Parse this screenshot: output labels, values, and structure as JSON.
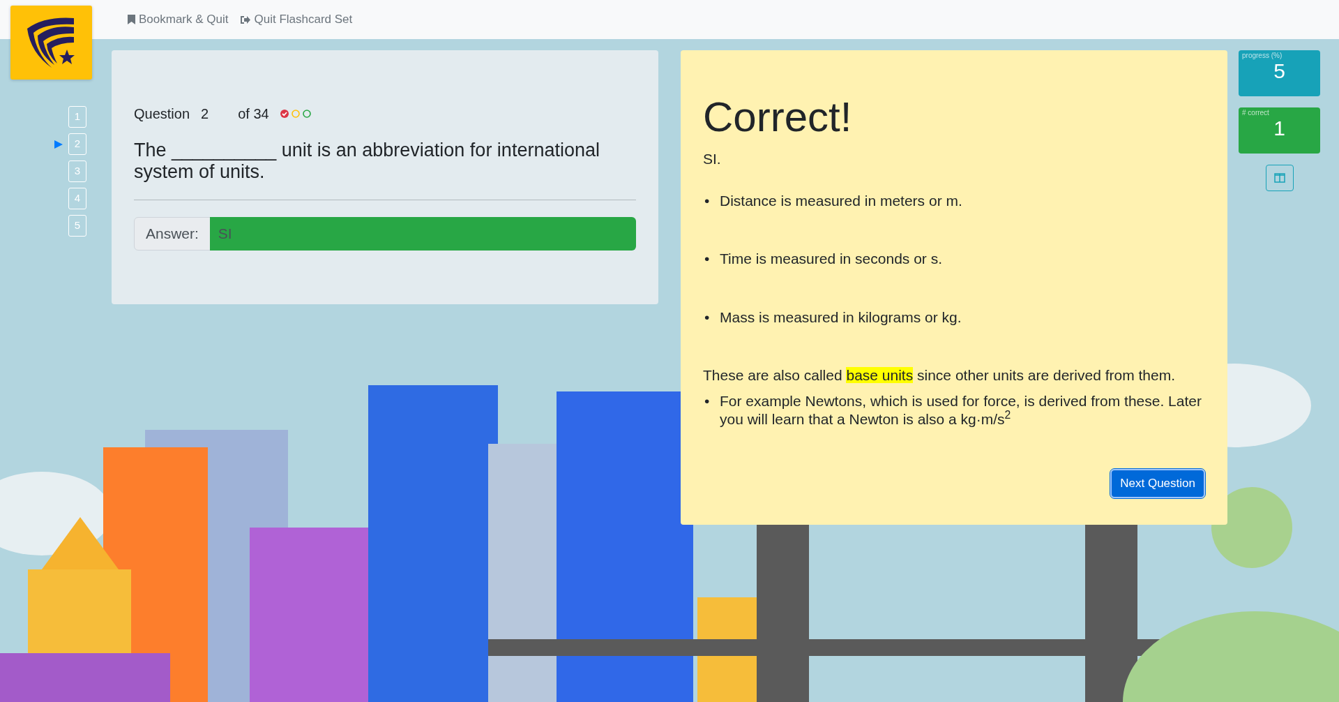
{
  "nav": {
    "links": [
      {
        "label": "Bookmark & Quit",
        "kind": "bookmark"
      },
      {
        "label": "Quit Flashcard Set",
        "kind": "quit"
      }
    ]
  },
  "question_list": [
    {
      "label": "1",
      "selected": false
    },
    {
      "label": "2",
      "selected": true
    },
    {
      "label": "3",
      "selected": false
    },
    {
      "label": "4",
      "selected": false
    },
    {
      "label": "5",
      "selected": false
    }
  ],
  "question": {
    "label": "Question",
    "number": "2",
    "total": "of 34",
    "status_dots": [
      {
        "color": "#dc3545",
        "checked": true
      },
      {
        "color": "#ffc107",
        "checked": false
      },
      {
        "color": "#28a745",
        "checked": false
      }
    ],
    "text": "The __________ unit is an abbreviation for international system of units.",
    "answer_label": "Answer:",
    "answer_value": "SI",
    "correct": true
  },
  "feedback": {
    "title": "Correct!",
    "answer": "SI.",
    "bullets": [
      {
        "marker": "•",
        "text": "Distance is measured in meters or m."
      },
      {
        "marker": "•",
        "text": "Time is measured in seconds or s."
      },
      {
        "marker": "•",
        "text": "Mass is measured in kilograms or kg."
      }
    ],
    "note": [
      {
        "text": "These are also called ",
        "highlight": false
      },
      {
        "text": "base units",
        "highlight": true
      },
      {
        "text": " since other units are derived from them.",
        "highlight": false
      }
    ],
    "sub_bullets": [
      {
        "marker": "•",
        "text": "For example Newtons, which is used for force, is derived from these. Later you will learn that a Newton is also a kg·m/s$^{2}$"
      }
    ],
    "button": "Next Question"
  },
  "stats": [
    {
      "label": "progress (%)",
      "value": "5",
      "color": "#17a2b8"
    },
    {
      "label": "# correct",
      "value": "1",
      "color": "#28a745"
    }
  ]
}
